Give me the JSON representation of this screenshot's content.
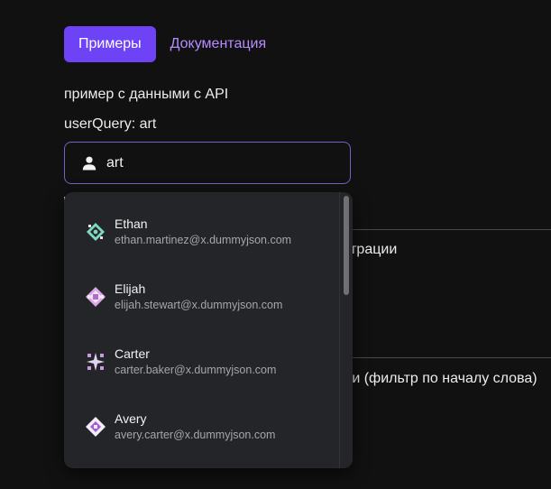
{
  "tabs": {
    "active_label": "Примеры",
    "link_label": "Документация"
  },
  "section": {
    "caption": "пример с данными с API",
    "query_text": "userQuery: art"
  },
  "search": {
    "value": "art",
    "icon": "user-icon"
  },
  "background_text": {
    "line1_fragment": "ьтрации",
    "line2_fragment": "ли (фильтр по началу слова)"
  },
  "results": [
    {
      "name": "Ethan",
      "email": "ethan.martinez@x.dummyjson.com",
      "icon": "avatar-identicon"
    },
    {
      "name": "Elijah",
      "email": "elijah.stewart@x.dummyjson.com",
      "icon": "avatar-identicon"
    },
    {
      "name": "Carter",
      "email": "carter.baker@x.dummyjson.com",
      "icon": "avatar-identicon"
    },
    {
      "name": "Avery",
      "email": "avery.carter@x.dummyjson.com",
      "icon": "avatar-identicon"
    }
  ],
  "colors": {
    "accent": "#6d43f5",
    "link": "#b58cff",
    "background": "#111112",
    "dropdown": "#242528"
  }
}
